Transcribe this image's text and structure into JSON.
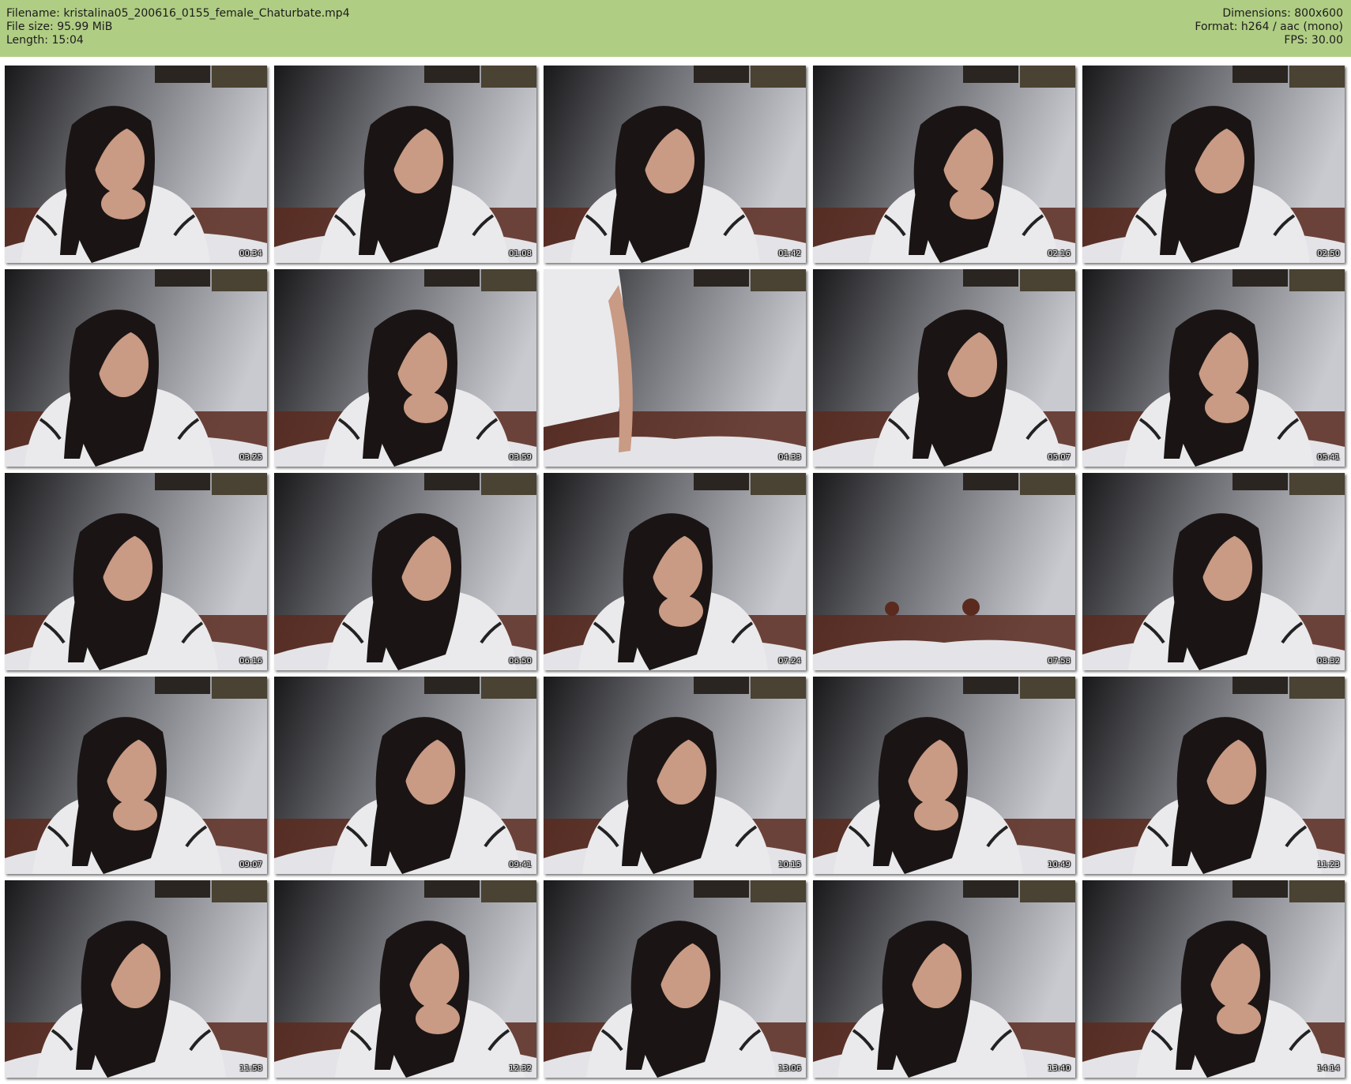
{
  "info": {
    "filename_label": "Filename:",
    "filename": "kristalina05_200616_0155_female_Chaturbate.mp4",
    "filesize_label": "File size:",
    "filesize": "95.99 MiB",
    "length_label": "Length:",
    "length": "15:04",
    "dimensions_label": "Dimensions:",
    "dimensions": "800x600",
    "format_label": "Format:",
    "format": "h264 / aac (mono)",
    "fps_label": "FPS:",
    "fps": "30.00"
  },
  "colors": {
    "header_bg": "#b0cd84",
    "wall": "#c9cad0",
    "dark": "#18181a",
    "headboard": "#5a2a1e",
    "shirt": "#eaeaec",
    "hair": "#1a1514",
    "skin": "#c99a84"
  },
  "thumbnails": [
    {
      "time": "00:34",
      "scene": "person"
    },
    {
      "time": "01:08",
      "scene": "person"
    },
    {
      "time": "01:42",
      "scene": "person"
    },
    {
      "time": "02:16",
      "scene": "person"
    },
    {
      "time": "02:50",
      "scene": "person"
    },
    {
      "time": "03:25",
      "scene": "person"
    },
    {
      "time": "03:59",
      "scene": "person"
    },
    {
      "time": "04:33",
      "scene": "standing"
    },
    {
      "time": "05:07",
      "scene": "person"
    },
    {
      "time": "05:41",
      "scene": "person"
    },
    {
      "time": "06:16",
      "scene": "person"
    },
    {
      "time": "06:50",
      "scene": "person"
    },
    {
      "time": "07:24",
      "scene": "person"
    },
    {
      "time": "07:58",
      "scene": "empty"
    },
    {
      "time": "08:32",
      "scene": "person"
    },
    {
      "time": "09:07",
      "scene": "person"
    },
    {
      "time": "09:41",
      "scene": "person"
    },
    {
      "time": "10:15",
      "scene": "person"
    },
    {
      "time": "10:49",
      "scene": "person"
    },
    {
      "time": "11:23",
      "scene": "person"
    },
    {
      "time": "11:58",
      "scene": "person"
    },
    {
      "time": "12:32",
      "scene": "person"
    },
    {
      "time": "13:06",
      "scene": "person"
    },
    {
      "time": "13:40",
      "scene": "person"
    },
    {
      "time": "14:14",
      "scene": "person"
    }
  ]
}
